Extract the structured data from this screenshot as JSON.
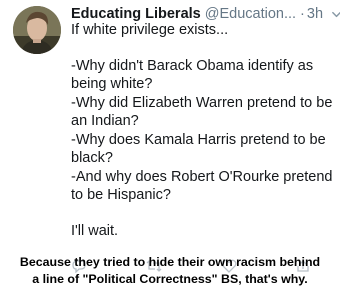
{
  "tweet": {
    "author_name": "Educating Liberals",
    "handle": "@Education...",
    "separator": "·",
    "time": "3h",
    "lines": [
      "If white privilege exists...",
      "",
      "-Why didn't Barack Obama identify as",
      "being white?",
      "-Why did Elizabeth Warren pretend to be",
      "an Indian?",
      "-Why does Kamala Harris pretend to be",
      "black?",
      "-And why does Robert O'Rourke pretend",
      "to be Hispanic?",
      "",
      "I'll wait."
    ]
  },
  "caption": {
    "line1": "Because they tried to hide their own racism behind",
    "line2": "a line of \"Political Correctness\" BS, that's why."
  },
  "icons": {
    "menu": "chevron-down-icon",
    "reply": "reply-icon",
    "retweet": "retweet-icon",
    "like": "heart-icon",
    "share": "share-icon"
  }
}
